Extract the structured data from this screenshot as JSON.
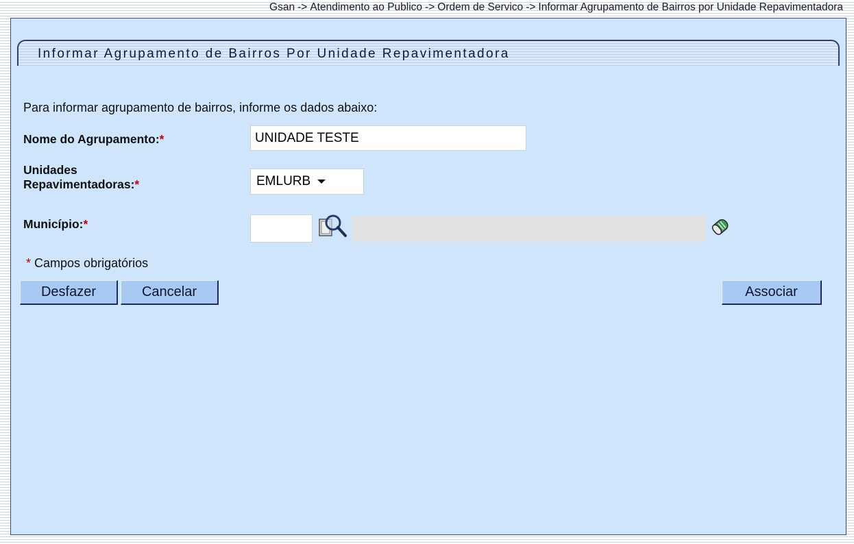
{
  "breadcrumb": {
    "items": [
      "Gsan",
      "Atendimento ao Publico",
      "Ordem de Servico",
      "Informar Agrupamento de Bairros por Unidade Repavimentadora"
    ],
    "separator": "->"
  },
  "page": {
    "title": "Informar Agrupamento de Bairros Por Unidade Repavimentadora",
    "instruction": "Para informar agrupamento de bairros, informe os dados abaixo:"
  },
  "form": {
    "nome": {
      "label": "Nome do Agrupamento:",
      "required_mark": "*",
      "value": "UNIDADE TESTE"
    },
    "unidades": {
      "label_line1": "Unidades",
      "label_line2": "Repavimentadoras:",
      "required_mark": "*",
      "selected": "EMLURB"
    },
    "municipio": {
      "label": "Município:",
      "required_mark": "*",
      "code_value": "",
      "description_value": ""
    },
    "required_note": {
      "mark": "*",
      "text": "Campos obrigatórios"
    }
  },
  "buttons": {
    "desfazer": "Desfazer",
    "cancelar": "Cancelar",
    "associar": "Associar"
  },
  "icons": {
    "lookup": "search-lookup-icon",
    "clear": "eraser-icon"
  },
  "colors": {
    "panel_bg": "#cfe5fb",
    "button_bg": "#a7c9f2",
    "required": "#cc0000",
    "border": "#2c3d78"
  }
}
